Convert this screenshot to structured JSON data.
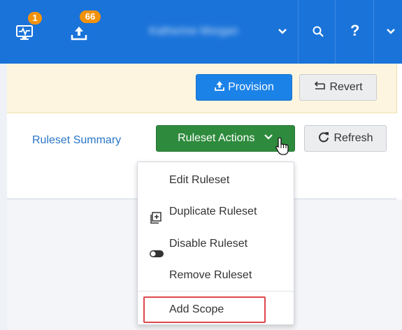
{
  "header": {
    "monitor_badge": "1",
    "upload_badge": "66",
    "user_name": "Katherine Morgan",
    "icons": [
      "monitor-icon",
      "upload-icon",
      "chevron-down-icon",
      "search-icon",
      "help-icon",
      "chevron-down-icon"
    ],
    "help_label": "?"
  },
  "banner": {
    "provision_label": "Provision",
    "revert_label": "Revert"
  },
  "toolbar": {
    "summary_link": "Ruleset Summary",
    "actions_label": "Ruleset Actions",
    "refresh_label": "Refresh"
  },
  "menu": {
    "items": [
      {
        "label": "Edit Ruleset"
      },
      {
        "label": "Duplicate Ruleset",
        "icon": "duplicate-icon"
      },
      {
        "label": "Disable Ruleset",
        "icon": "toggle-icon"
      },
      {
        "label": "Remove Ruleset"
      },
      {
        "label": "Add Scope"
      }
    ]
  },
  "colors": {
    "topbar": "#1a73d9",
    "badge": "#f2920c",
    "provision": "#1b82e8",
    "actions": "#2e8b3d",
    "highlight": "#e0474c",
    "banner": "#fdf5df"
  }
}
